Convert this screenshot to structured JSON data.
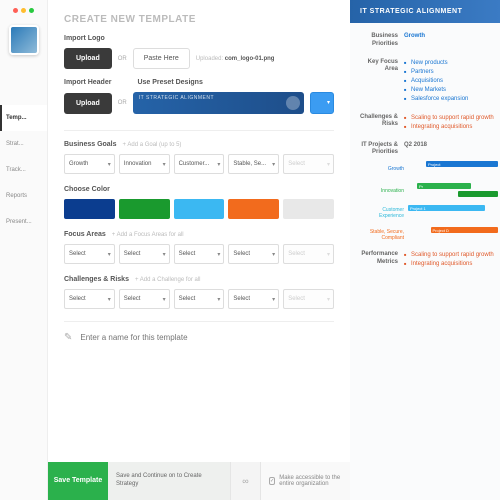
{
  "nav": [
    "Temp...",
    "Strat...",
    "Track...",
    "Reports",
    "Present..."
  ],
  "page_title": "CREATE NEW TEMPLATE",
  "logo": {
    "label": "Import Logo",
    "upload": "Upload",
    "or": "OR",
    "paste": "Paste Here",
    "uploaded_label": "Uploaded:",
    "uploaded_file": "com_logo-01.png"
  },
  "header": {
    "label": "Import Header",
    "upload": "Upload",
    "or": "OR",
    "preset_label": "Use Preset Designs",
    "preset_text": "IT STRATEGIC ALIGNMENT"
  },
  "goals": {
    "label": "Business Goals",
    "hint": "+ Add a Goal (up to 5)",
    "items": [
      "Growth",
      "Innovation",
      "Customer...",
      "Stable, Se...",
      "Select"
    ]
  },
  "color": {
    "label": "Choose Color"
  },
  "swatches": [
    "#0b3d8f",
    "#1a9a2e",
    "#3bb8f2",
    "#f26b1d",
    "#e8e8e8"
  ],
  "focus": {
    "label": "Focus Areas",
    "hint": "+ Add a Focus Areas for all",
    "items": [
      "Select",
      "Select",
      "Select",
      "Select",
      "Select"
    ]
  },
  "challenges": {
    "label": "Challenges & Risks",
    "hint": "+ Add a Challenge for all",
    "items": [
      "Select",
      "Select",
      "Select",
      "Select",
      "Select"
    ]
  },
  "name_placeholder": "Enter a name for this template",
  "footer": {
    "save": "Save Template",
    "save_continue": "Save and Continue on to Create Strategy",
    "access": "Make accessible to the entire organization"
  },
  "preview": {
    "title": "IT STRATEGIC ALIGNMENT",
    "biz_priorities_label": "Business Priorities",
    "biz_priorities_value": "Growth",
    "key_focus_label": "Key Focus Area",
    "key_focus": [
      "New products",
      "Partners",
      "Acquisitions",
      "New Markets",
      "Salesforce expansion"
    ],
    "chal_label": "Challenges & Risks",
    "challenges": [
      "Scaling to support rapid growth",
      "Integrating acquisitions"
    ],
    "proj_label": "IT Projects & Priorities",
    "proj_period": "Q2 2018",
    "lanes": [
      "Growth",
      "Innovation",
      "Customer Experience",
      "Stable, Secure, Compliant"
    ],
    "perf_label": "Performance Metrics",
    "perf": [
      "Scaling to support rapid growth",
      "Integrating acquisitions"
    ]
  }
}
